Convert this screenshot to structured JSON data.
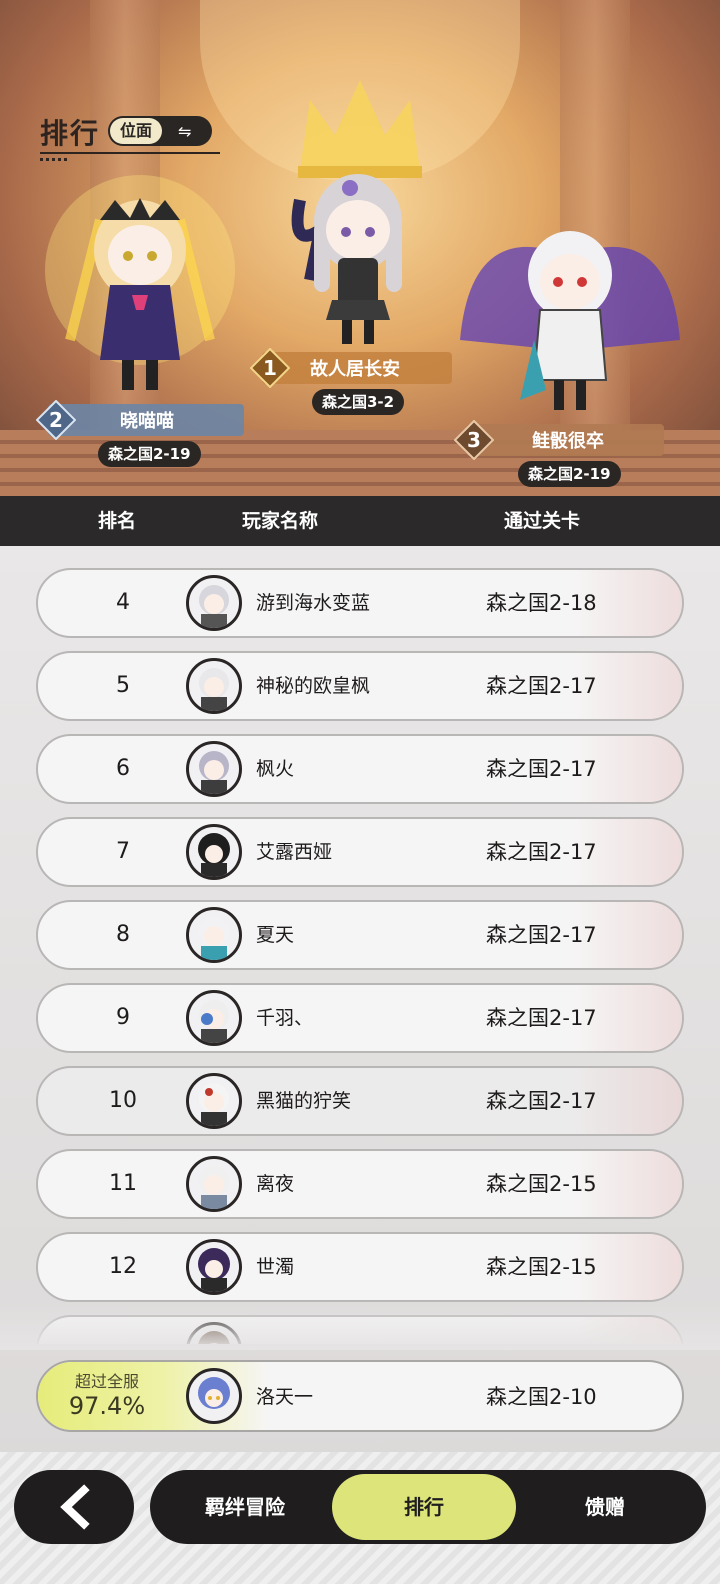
{
  "header_section": {
    "title": "排行",
    "toggle_label": "位面"
  },
  "podium": [
    {
      "rank": "1",
      "name": "故人居长安",
      "stage": "森之国3-2"
    },
    {
      "rank": "2",
      "name": "晓喵喵",
      "stage": "森之国2-19"
    },
    {
      "rank": "3",
      "name": "鲑骰很卒",
      "stage": "森之国2-19"
    }
  ],
  "columns": {
    "rank": "排名",
    "player": "玩家名称",
    "stage": "通过关卡"
  },
  "rows": [
    {
      "rank": "4",
      "name": "游到海水变蓝",
      "stage": "森之国2-18"
    },
    {
      "rank": "5",
      "name": "神秘的欧皇枫",
      "stage": "森之国2-17"
    },
    {
      "rank": "6",
      "name": "枫火",
      "stage": "森之国2-17"
    },
    {
      "rank": "7",
      "name": "艾露西娅",
      "stage": "森之国2-17"
    },
    {
      "rank": "8",
      "name": "夏天",
      "stage": "森之国2-17"
    },
    {
      "rank": "9",
      "name": "千羽、",
      "stage": "森之国2-17"
    },
    {
      "rank": "10",
      "name": "黑猫的狞笑",
      "stage": "森之国2-17"
    },
    {
      "rank": "11",
      "name": "离夜",
      "stage": "森之国2-15"
    },
    {
      "rank": "12",
      "name": "世濁",
      "stage": "森之国2-15"
    }
  ],
  "my_rank": {
    "label": "超过全服",
    "percent": "97.4%",
    "name": "洛天一",
    "stage": "森之国2-10"
  },
  "nav": {
    "tabs": [
      "羁绊冒险",
      "排行",
      "馈赠"
    ],
    "active": "排行"
  },
  "colors": {
    "accent": "#dce47a",
    "dark": "#1f1d1d",
    "header_bg": "#2b2929"
  }
}
